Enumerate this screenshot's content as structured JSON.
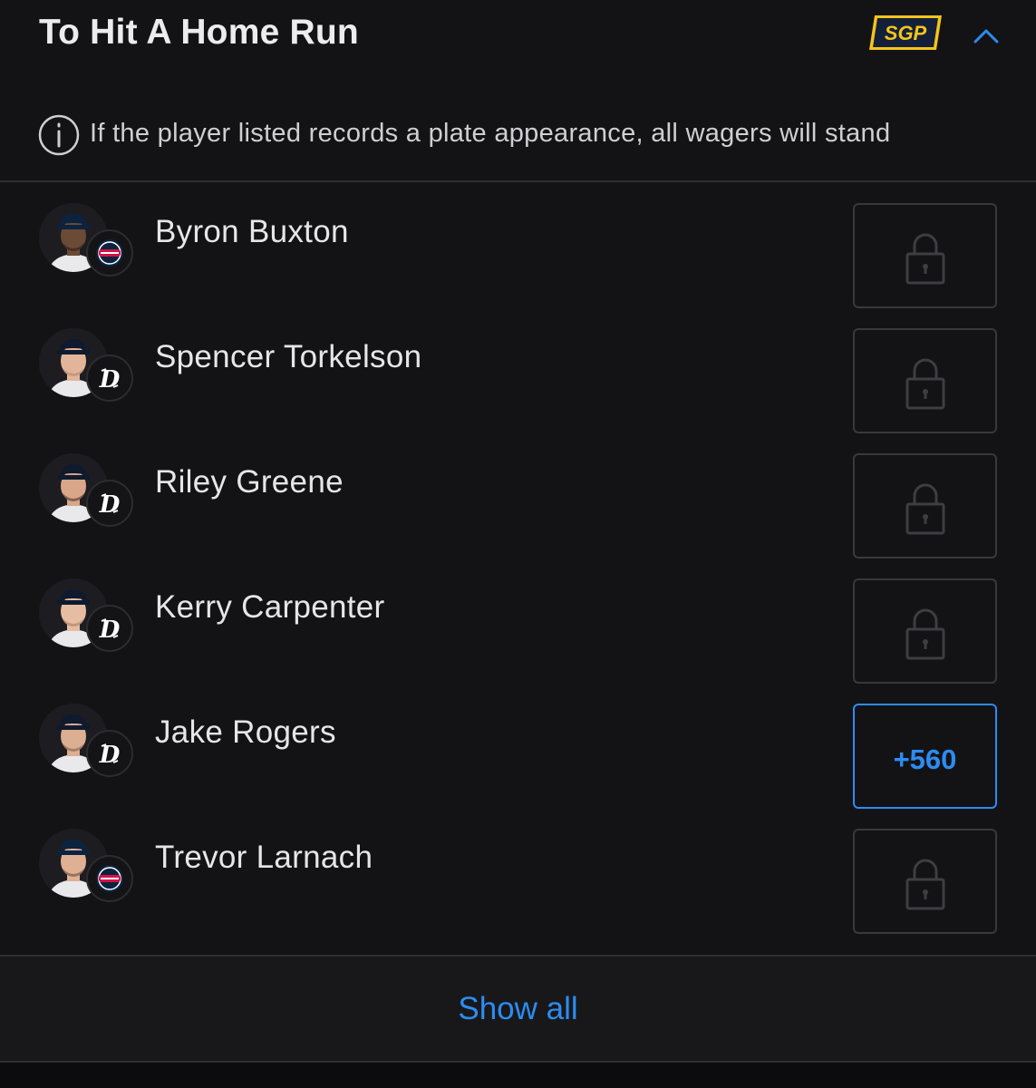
{
  "market": {
    "title": "To Hit A Home Run",
    "sgp_badge": "SGP",
    "info_text": "If the player listed records a plate appearance, all wagers will stand"
  },
  "players": [
    {
      "name": "Byron Buxton",
      "team_icon": "twins-logo-icon",
      "odds": null,
      "locked": true
    },
    {
      "name": "Spencer Torkelson",
      "team_icon": "tigers-logo-icon",
      "odds": null,
      "locked": true
    },
    {
      "name": "Riley Greene",
      "team_icon": "tigers-logo-icon",
      "odds": null,
      "locked": true
    },
    {
      "name": "Kerry Carpenter",
      "team_icon": "tigers-logo-icon",
      "odds": null,
      "locked": true
    },
    {
      "name": "Jake Rogers",
      "team_icon": "tigers-logo-icon",
      "odds": "+560",
      "locked": false
    },
    {
      "name": "Trevor Larnach",
      "team_icon": "twins-logo-icon",
      "odds": null,
      "locked": true
    }
  ],
  "footer": {
    "show_all_label": "Show all"
  },
  "colors": {
    "background": "#131316",
    "accent_blue": "#2d8cf0",
    "sgp_yellow": "#f5c518",
    "twins_navy": "#0c2340",
    "twins_red": "#d31145"
  }
}
